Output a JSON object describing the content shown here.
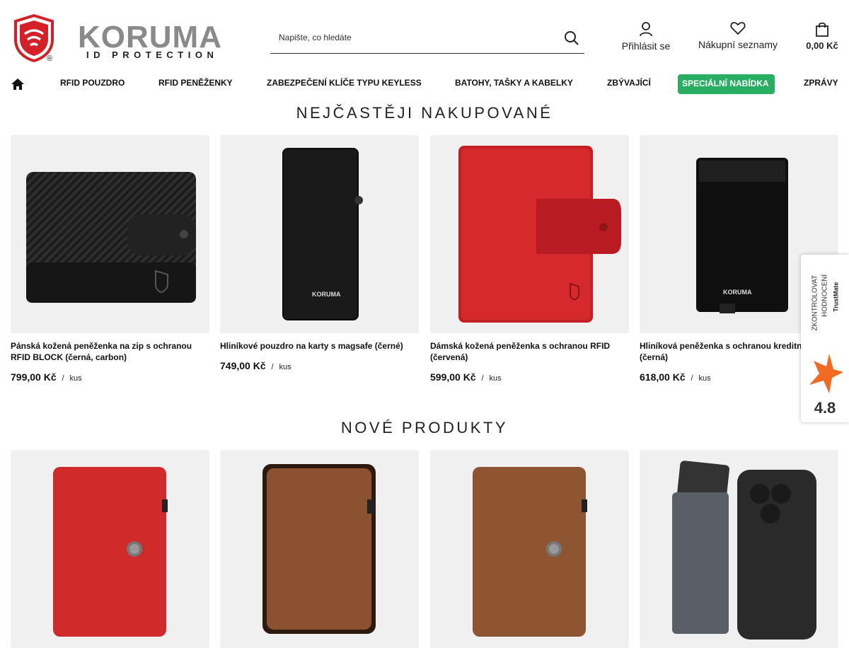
{
  "brand": {
    "name": "KORUMA",
    "tagline": "ID PROTECTION",
    "reg": "®",
    "accent": "#d62027"
  },
  "search": {
    "placeholder": "Napište, co hledáte"
  },
  "header": {
    "login": "Přihlásit se",
    "wishlist": "Nákupní seznamy",
    "cart_total": "0,00 Kč"
  },
  "nav": {
    "items": [
      "RFID POUZDRO",
      "RFID PENĚŽENKY",
      "ZABEZPEČENÍ KLÍČE TYPU KEYLESS",
      "BATOHY, TAŠKY A KABELKY",
      "ZBÝVAJÍCÍ",
      "SPECIÁLNÍ NABÍDKA",
      "ZPRÁVY"
    ],
    "special_color": "#27ae60"
  },
  "bestsellers": {
    "title": "NEJČASTĚJI NAKUPOVANÉ",
    "products": [
      {
        "name": "Pánská kožená peněženka na zip s ochranou RFID BLOCK (černá, carbon)",
        "price": "799,00 Kč",
        "unit": "kus"
      },
      {
        "name": "Hliníkové pouzdro na karty s magsafe (černé)",
        "price": "749,00 Kč",
        "unit": "kus"
      },
      {
        "name": "Dámská kožená peněženka s ochranou RFID (červená)",
        "price": "599,00 Kč",
        "unit": "kus"
      },
      {
        "name": "Hliníková peněženka s ochranou kreditní RFID (černá)",
        "price": "618,00 Kč",
        "unit": "kus"
      }
    ]
  },
  "new_products": {
    "title": "NOVÉ PRODUKTY"
  },
  "trustmate": {
    "label": "ZKONTROLOVAT HODNOCENÍ",
    "brand": "TrustMate",
    "rating": "4.8"
  }
}
